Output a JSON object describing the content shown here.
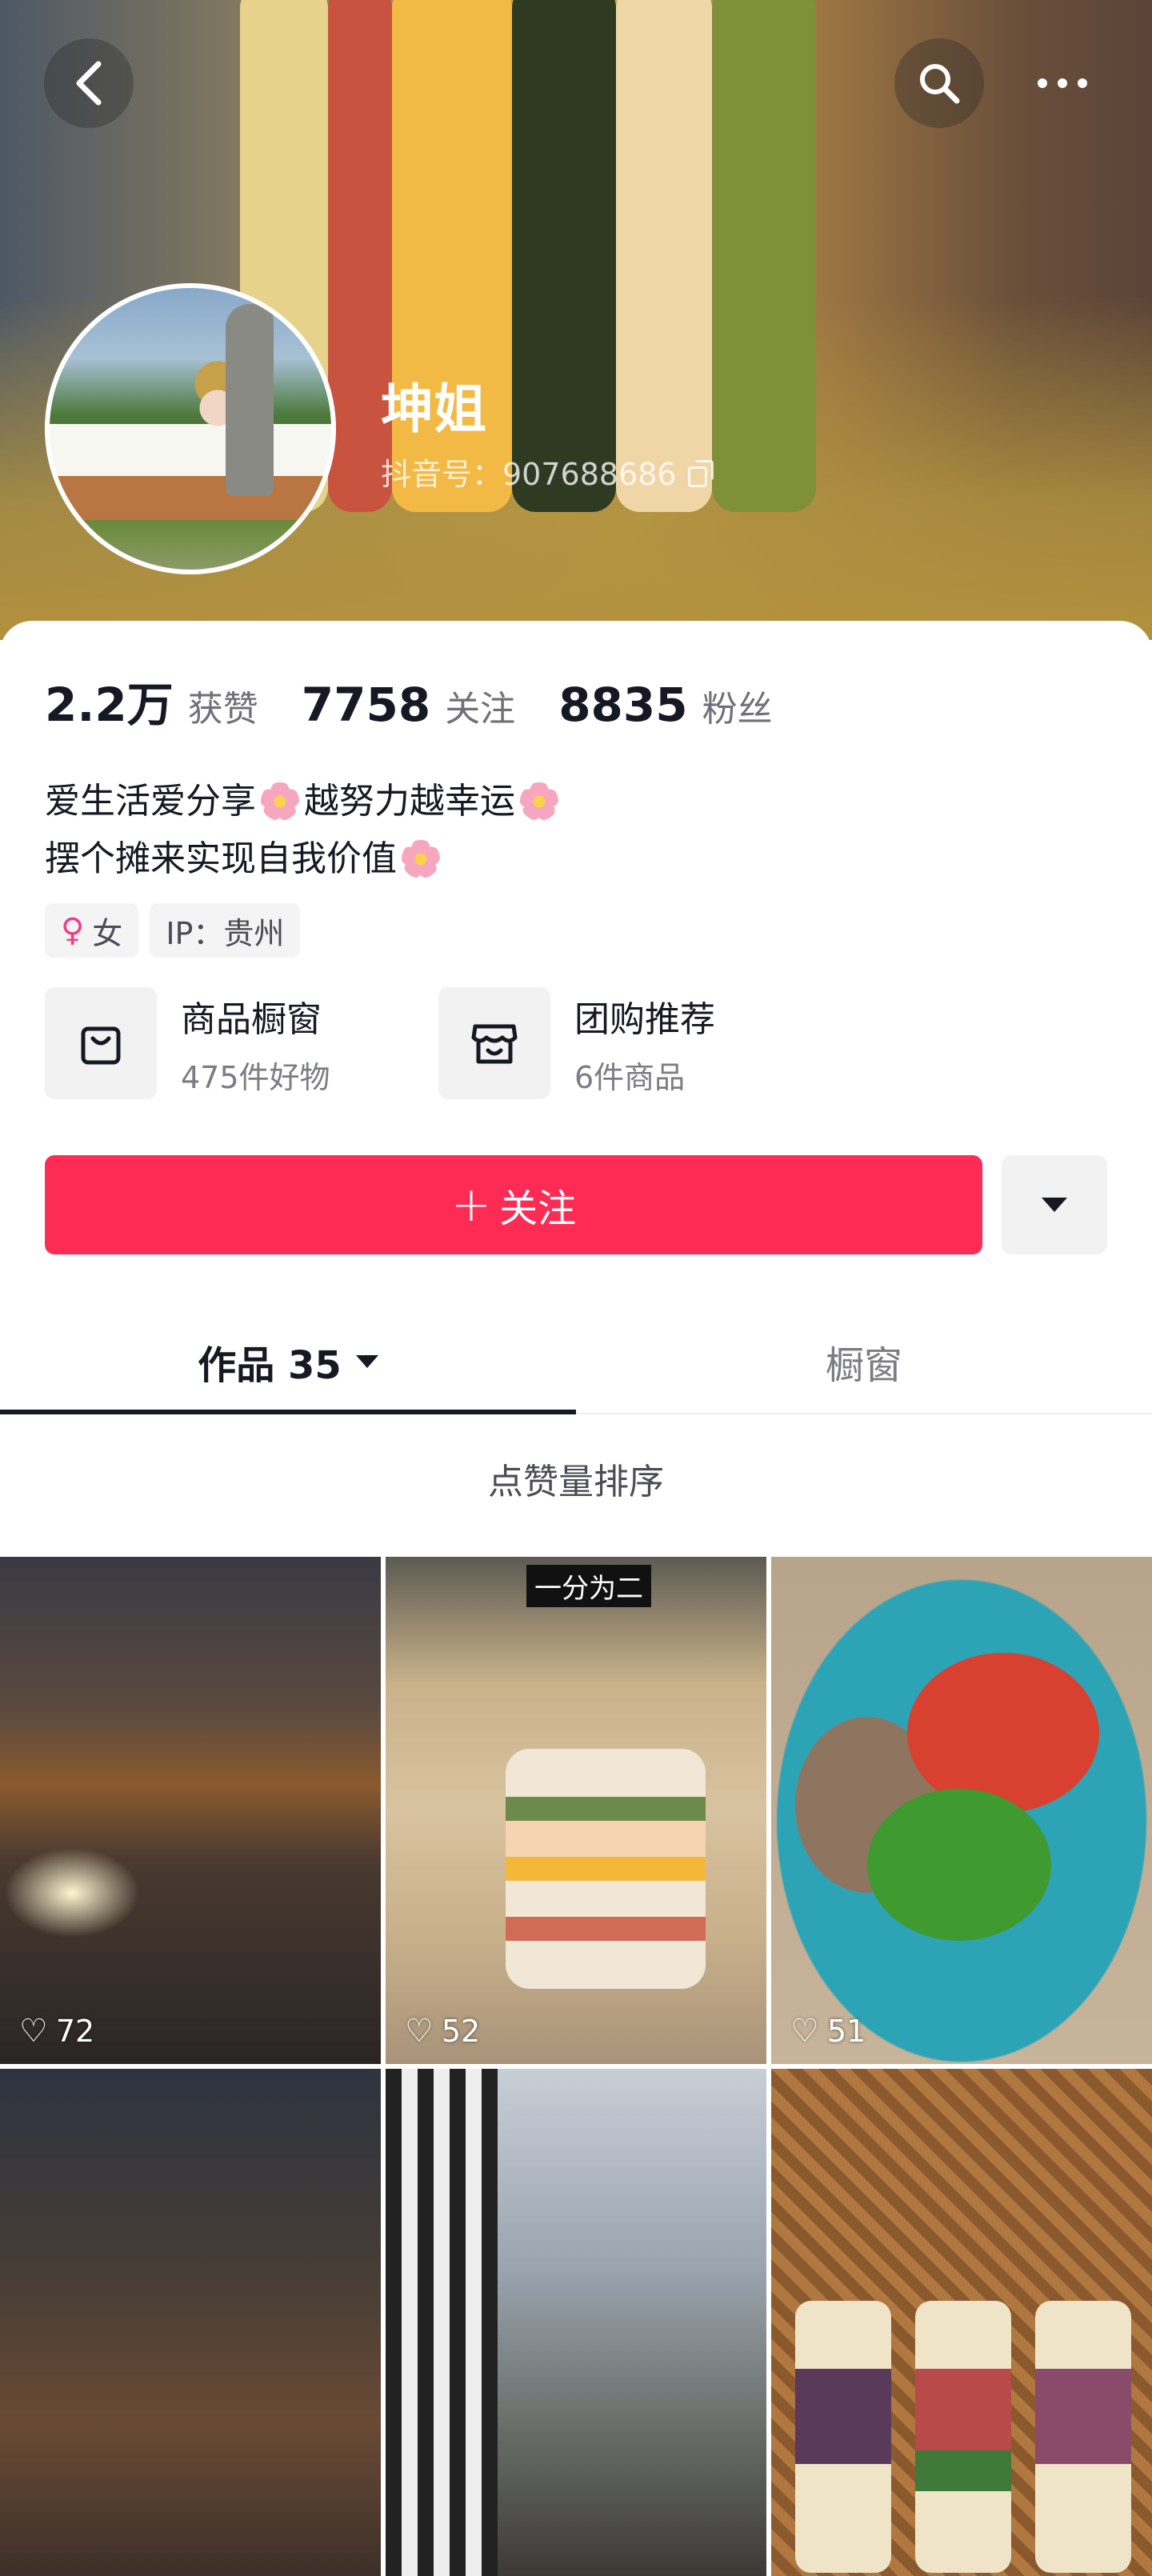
{
  "header": {
    "nickname": "坤姐",
    "douyin_id": "抖音号：907688686",
    "icons": [
      "back-icon",
      "search-icon",
      "more-icon"
    ]
  },
  "stats": [
    {
      "value": "2.2万",
      "label": "获赞"
    },
    {
      "value": "7758",
      "label": "关注"
    },
    {
      "value": "8835",
      "label": "粉丝"
    }
  ],
  "bio": {
    "line1_part1": "爱生活爱分享",
    "line1_part2": "越努力越幸运",
    "line2": "摆个摊来实现自我价值"
  },
  "tags": {
    "gender": "女",
    "ip": "IP：贵州"
  },
  "shops": [
    {
      "title": "商品橱窗",
      "subtitle": "475件好物"
    },
    {
      "title": "团购推荐",
      "subtitle": "6件商品"
    }
  ],
  "actions": {
    "follow_label": "关注",
    "follow_color": "#fe2c55"
  },
  "tabs": {
    "works": "作品 35",
    "window": "橱窗"
  },
  "sort_label": "点赞量排序",
  "videos": [
    {
      "likes": "72"
    },
    {
      "likes": "52",
      "overlay_text": "一分为二"
    },
    {
      "likes": "51"
    },
    {
      "likes": ""
    },
    {
      "likes": ""
    },
    {
      "likes": ""
    }
  ]
}
